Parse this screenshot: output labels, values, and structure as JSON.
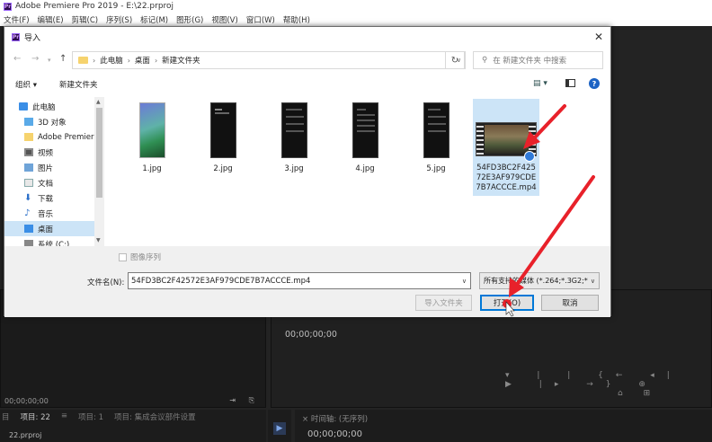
{
  "app": {
    "title": "Adobe Premiere Pro 2019 - E:\\22.prproj",
    "logo_text": "Pr",
    "menu": [
      "文件(F)",
      "编辑(E)",
      "剪辑(C)",
      "序列(S)",
      "标记(M)",
      "图形(G)",
      "视图(V)",
      "窗口(W)",
      "帮助(H)"
    ]
  },
  "premiere": {
    "source_timecode": "00;00;00;00",
    "program_timecode": "00;00;00;00",
    "timeline_timecode": "00;00;00;00",
    "bottom_tabs": [
      "目",
      "项目: 22",
      "≡",
      "项目: 1",
      "项目: 集成会议部件设置"
    ],
    "project_file": "22.prproj",
    "timeline_tab": "× 时间轴: (无序列)"
  },
  "dialog": {
    "title": "导入",
    "logo_text": "Pr",
    "breadcrumbs": [
      "此电脑",
      "桌面",
      "新建文件夹"
    ],
    "search_placeholder": "在 新建文件夹 中搜索",
    "organize_label": "组织 ▾",
    "new_folder_label": "新建文件夹",
    "nav_items": [
      {
        "label": "此电脑",
        "icon": "computer-icon",
        "selected": false
      },
      {
        "label": "3D 对象",
        "icon": "cube-icon",
        "selected": false
      },
      {
        "label": "Adobe Premier",
        "icon": "folder-icon",
        "selected": false
      },
      {
        "label": "视频",
        "icon": "video-icon",
        "selected": false
      },
      {
        "label": "图片",
        "icon": "picture-icon",
        "selected": false
      },
      {
        "label": "文档",
        "icon": "document-icon",
        "selected": false
      },
      {
        "label": "下载",
        "icon": "download-icon",
        "selected": false
      },
      {
        "label": "音乐",
        "icon": "music-icon",
        "selected": false
      },
      {
        "label": "桌面",
        "icon": "desktop-icon",
        "selected": true
      },
      {
        "label": "系统 (C:)",
        "icon": "drive-icon",
        "selected": false
      }
    ],
    "files": [
      {
        "name": "1.jpg",
        "kind": "phone-wallpaper",
        "selected": false
      },
      {
        "name": "2.jpg",
        "kind": "phone-dark",
        "selected": false
      },
      {
        "name": "3.jpg",
        "kind": "phone-dark",
        "selected": false
      },
      {
        "name": "4.jpg",
        "kind": "phone-dark",
        "selected": false
      },
      {
        "name": "5.jpg",
        "kind": "phone-dark",
        "selected": false
      },
      {
        "name": "54FD3BC2F42572E3AF979CDE7B7ACCCE.mp4",
        "name_lines": [
          "54FD3BC2F425",
          "72E3AF979CDE",
          "7B7ACCCE.mp4"
        ],
        "kind": "video",
        "selected": true
      }
    ],
    "image_sequence_label": "图像序列",
    "filename_label": "文件名(N):",
    "filename_value": "54FD3BC2F42572E3AF979CDE7B7ACCCE.mp4",
    "filetype_value": "所有支持的媒体 (*.264;*.3G2;*",
    "import_folder_label": "导入文件夹",
    "open_label": "打开(O)",
    "cancel_label": "取消"
  },
  "colors": {
    "selection": "#cce4f7",
    "accent_blue": "#0078d7",
    "annotation_red": "#e8212a"
  }
}
